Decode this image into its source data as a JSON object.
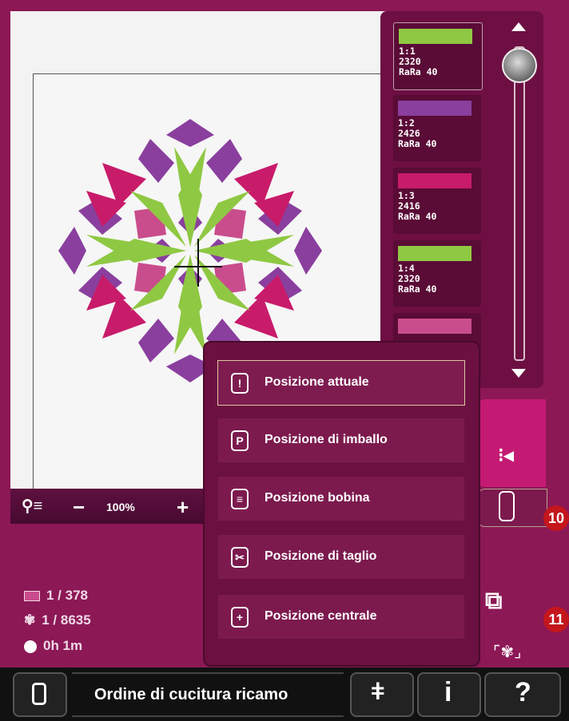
{
  "colors": {
    "green": "#8fc843",
    "purple": "#8a3f9e",
    "magenta": "#c81b6a",
    "pink": "#c94d8c"
  },
  "color_list": [
    {
      "label": "1:1\n2320\nRaRa 40",
      "color": "#8fc843",
      "selected": true
    },
    {
      "label": "1:2\n2426\nRaRa 40",
      "color": "#8a3f9e",
      "selected": false
    },
    {
      "label": "1:3\n2416\nRaRa 40",
      "color": "#c81b6a",
      "selected": false
    },
    {
      "label": "1:4\n2320\nRaRa 40",
      "color": "#8fc843",
      "selected": false
    },
    {
      "label": "",
      "color": "#c94d8c",
      "selected": false
    }
  ],
  "zoom": {
    "minus": "−",
    "value": "100%",
    "plus": "+"
  },
  "info": {
    "blocks": "1 / 378",
    "stitches": "1 / 8635",
    "time": "0h 1m"
  },
  "menu": {
    "items": [
      {
        "label": "Posizione attuale",
        "icon": "!"
      },
      {
        "label": "Posizione di imballo",
        "icon": "P"
      },
      {
        "label": "Posizione bobina",
        "icon": "≡"
      },
      {
        "label": "Posizione di taglio",
        "icon": "✂"
      },
      {
        "label": "Posizione centrale",
        "icon": "+"
      }
    ]
  },
  "bottom": {
    "title": "Ordine di cucitura ricamo"
  },
  "callouts": {
    "a": "10",
    "b": "11"
  }
}
